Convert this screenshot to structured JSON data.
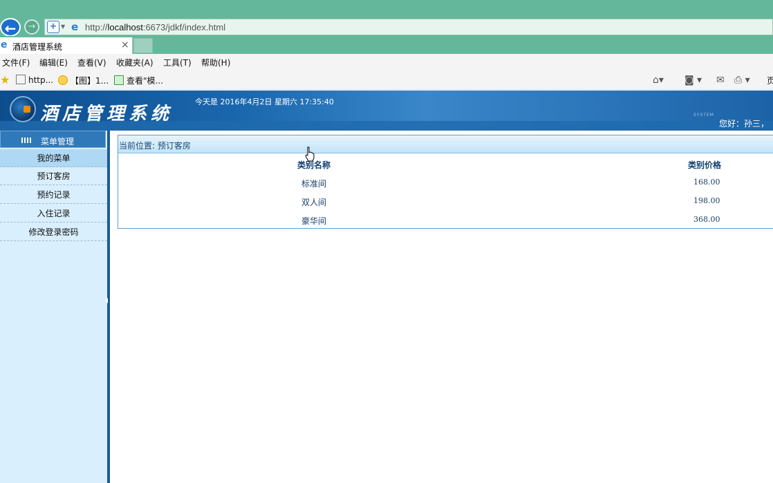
{
  "browser": {
    "url_prefix": "http://",
    "url_host": "localhost",
    "url_rest": ":6673/jdkf/index.html",
    "tab_title": "酒店管理系统",
    "tab_close": "×",
    "menu": [
      "文件(F)",
      "编辑(E)",
      "查看(V)",
      "收藏夹(A)",
      "工具(T)",
      "帮助(H)"
    ],
    "favorites": [
      "http...",
      "【图】1...",
      "查看\"模..."
    ],
    "page_menu_fragment": "页"
  },
  "header": {
    "app_title": "酒店管理系统",
    "date_text": "今天是 2016年4月2日 星期六 17:35:40",
    "system_mark": "SYSTEM",
    "greeting": "您好：孙三，"
  },
  "sidebar": {
    "title": "菜单管理",
    "items": [
      {
        "label": "我的菜单",
        "active": true
      },
      {
        "label": "预订客房",
        "active": false
      },
      {
        "label": "预约记录",
        "active": false
      },
      {
        "label": "入住记录",
        "active": false
      },
      {
        "label": "修改登录密码",
        "active": false
      }
    ]
  },
  "main": {
    "breadcrumb": "当前位置: 预订客房",
    "columns": [
      "类别名称",
      "类别价格"
    ],
    "rows": [
      {
        "name": "标准间",
        "price": "168.00"
      },
      {
        "name": "双人间",
        "price": "198.00"
      },
      {
        "name": "豪华间",
        "price": "368.00"
      }
    ]
  },
  "colors": {
    "chrome_green": "#64b79b",
    "header_blue": "#1a66ad",
    "sidebar_bg": "#d9effd",
    "divider": "#1e5b93"
  }
}
